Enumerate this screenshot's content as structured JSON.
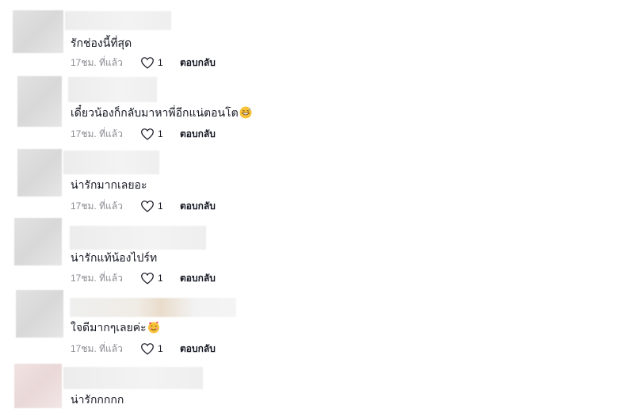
{
  "comments": [
    {
      "text": "รักช่องนี้ที่สุด",
      "time": "17ชม. ที่แล้ว",
      "likes": "1",
      "reply": "ตอบกลับ",
      "emoji": ""
    },
    {
      "text": "เดี๋ยวน้องก็กลับมาหาพี่อีกแน่ตอนโต",
      "time": "17ชม. ที่แล้ว",
      "likes": "1",
      "reply": "ตอบกลับ",
      "emoji": "grinning-sweat"
    },
    {
      "text": "น่ารักมากเลยอะ",
      "time": "17ชม. ที่แล้ว",
      "likes": "1",
      "reply": "ตอบกลับ",
      "emoji": ""
    },
    {
      "text": "น่ารักแท้น้องไปร์ท",
      "time": "17ชม. ที่แล้ว",
      "likes": "1",
      "reply": "ตอบกลับ",
      "emoji": ""
    },
    {
      "text": "ใจดีมากๆเลยค่ะ",
      "time": "17ชม. ที่แล้ว",
      "likes": "1",
      "reply": "ตอบกลับ",
      "emoji": "smiling-hearts"
    },
    {
      "text": "น่ารักกกกก",
      "time": "",
      "likes": "",
      "reply": "",
      "emoji": ""
    }
  ],
  "icons": {
    "like": "heart-outline-icon"
  },
  "colors": {
    "text": "#161823",
    "meta": "#8a8b91",
    "emoji_face": "#f7c23a"
  }
}
